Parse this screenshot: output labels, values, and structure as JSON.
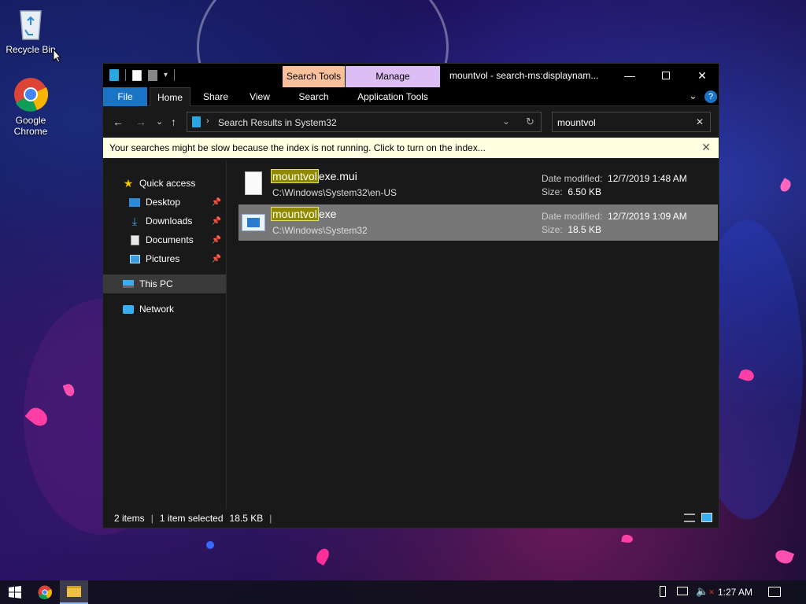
{
  "desktop": {
    "icons": [
      {
        "label": "Recycle Bin",
        "icon": "recycle-bin-icon"
      },
      {
        "label": "Google Chrome",
        "icon": "chrome-icon"
      }
    ]
  },
  "window": {
    "title": "mountvol - search-ms:displaynam...",
    "context_tabs": {
      "search_tools": "Search Tools",
      "manage": "Manage"
    },
    "ribbon_tabs": [
      "File",
      "Home",
      "Share",
      "View",
      "Search",
      "Application Tools"
    ],
    "address": {
      "breadcrumb": "Search Results in System32"
    },
    "search": {
      "value": "mountvol"
    },
    "infobar": {
      "message": "Your searches might be slow because the index is not running.  Click to turn on the index..."
    },
    "nav": {
      "quick_access": "Quick access",
      "items": [
        {
          "label": "Desktop",
          "pinned": true
        },
        {
          "label": "Downloads",
          "pinned": true
        },
        {
          "label": "Documents",
          "pinned": true
        },
        {
          "label": "Pictures",
          "pinned": true
        }
      ],
      "this_pc": "This PC",
      "network": "Network"
    },
    "files": [
      {
        "highlight": "mountvol",
        "rest": "exe.mui",
        "path": "C:\\Windows\\System32\\en-US",
        "date_label": "Date modified:",
        "date": "12/7/2019 1:48 AM",
        "size_label": "Size:",
        "size": "6.50 KB",
        "selected": false
      },
      {
        "highlight": "mountvol",
        "rest": "exe",
        "path": "C:\\Windows\\System32",
        "date_label": "Date modified:",
        "date": "12/7/2019 1:09 AM",
        "size_label": "Size:",
        "size": "18.5 KB",
        "selected": true
      }
    ],
    "status": {
      "count": "2 items",
      "selected": "1 item selected",
      "size": "18.5 KB"
    }
  },
  "taskbar": {
    "clock": "1:27 AM"
  },
  "colors": {
    "accent": "#1a74c4",
    "search_tools": "#f9c19b",
    "manage": "#dcbdf4",
    "highlight": "#8f8a00"
  }
}
